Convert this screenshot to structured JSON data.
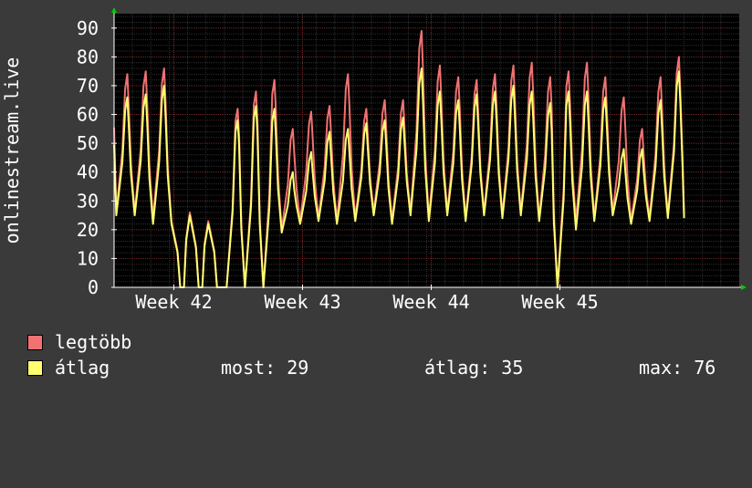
{
  "chart_data": {
    "type": "line",
    "ylabel": "onlinestream.live",
    "ylim": [
      0,
      95
    ],
    "yticks": [
      0,
      10,
      20,
      30,
      40,
      50,
      60,
      70,
      80,
      90
    ],
    "xlim": [
      0,
      34
    ],
    "x_ticks": [
      {
        "x": 3.25,
        "label": "Week 42"
      },
      {
        "x": 10.25,
        "label": "Week 43"
      },
      {
        "x": 17.25,
        "label": "Week 44"
      },
      {
        "x": 24.25,
        "label": "Week 45"
      }
    ],
    "grid": true,
    "colors": {
      "background": "#3a3a3a",
      "plot_bg": "#000000",
      "major_grid": "#7a2a2a",
      "minor_grid": "#2e2e2e",
      "axis": "#ffffff",
      "arrow": "#00cc00",
      "legtobb": "#f07272",
      "atlag": "#ffff70"
    },
    "series": [
      {
        "name": "legtöbb",
        "color": "#f07272",
        "peaks": [
          74,
          75,
          76,
          0,
          0,
          0,
          62,
          68,
          72,
          55,
          61,
          63,
          74,
          62,
          65,
          65,
          89,
          77,
          73,
          72,
          74,
          77,
          78,
          73,
          75,
          78,
          73,
          66,
          55,
          73,
          80
        ],
        "troughs": [
          26,
          24,
          23,
          26,
          23,
          0,
          0,
          0,
          20,
          23,
          24,
          23,
          24,
          26,
          23,
          26,
          24,
          26,
          24,
          26,
          25,
          26,
          24,
          0,
          23,
          24,
          26,
          23,
          24,
          25
        ]
      },
      {
        "name": "átlag",
        "color": "#ffff70",
        "peaks": [
          66,
          67,
          70,
          0,
          0,
          0,
          58,
          63,
          62,
          40,
          47,
          54,
          55,
          57,
          58,
          59,
          76,
          68,
          65,
          67,
          68,
          70,
          68,
          64,
          68,
          68,
          66,
          48,
          48,
          65,
          75
        ],
        "troughs": [
          25,
          22,
          22,
          25,
          22,
          0,
          0,
          0,
          19,
          22,
          23,
          22,
          23,
          25,
          22,
          25,
          23,
          25,
          23,
          25,
          24,
          25,
          23,
          0,
          20,
          23,
          25,
          22,
          23,
          24
        ]
      }
    ]
  },
  "legend": [
    {
      "label": "legtöbb",
      "color": "#f07272"
    },
    {
      "label": "átlag",
      "color": "#ffff70"
    }
  ],
  "stats": {
    "most": "most: 29",
    "atlag": "átlag: 35",
    "max": "max: 76"
  }
}
